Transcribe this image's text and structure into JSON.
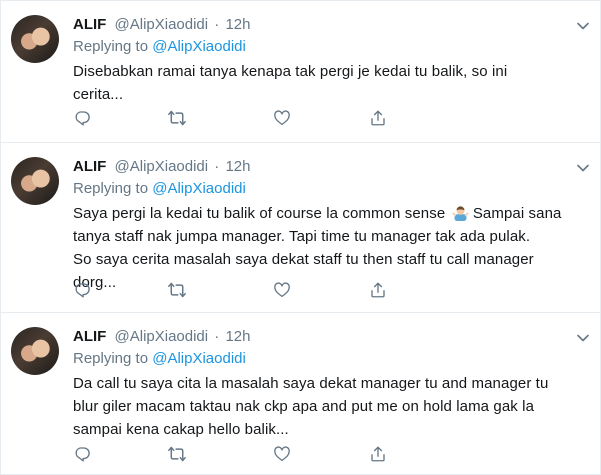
{
  "tweets": [
    {
      "name": "ALIF",
      "handle": "@AlipXiaodidi",
      "separator": "·",
      "time": "12h",
      "replying_prefix": "Replying to",
      "replying_handle": "@AlipXiaodidi",
      "text_lines": [
        "Disebabkan ramai tanya kenapa tak pergi je kedai tu balik, so ini",
        "cerita..."
      ]
    },
    {
      "name": "ALIF",
      "handle": "@AlipXiaodidi",
      "separator": "·",
      "time": "12h",
      "replying_prefix": "Replying to",
      "replying_handle": "@AlipXiaodidi",
      "text_line1_a": "Saya pergi la kedai tu balik of course la common sense",
      "text_line1_b": "Sampai sana",
      "text_lines_rest": [
        "tanya staff nak jumpa manager. Tapi time tu manager tak ada pulak.",
        "So saya cerita masalah saya dekat staff tu then staff tu call manager",
        "dorg..."
      ],
      "emoji_icon": "man-shrugging-emoji-icon"
    },
    {
      "name": "ALIF",
      "handle": "@AlipXiaodidi",
      "separator": "·",
      "time": "12h",
      "replying_prefix": "Replying to",
      "replying_handle": "@AlipXiaodidi",
      "text_lines": [
        "Da call tu saya cita la masalah saya dekat manager tu and manager tu",
        "blur giler macam taktau nak ckp apa and put me on hold lama gak la",
        "sampai kena cakap hello balik..."
      ]
    }
  ],
  "icons": {
    "reply": "reply-icon",
    "retweet": "retweet-icon",
    "like": "heart-icon",
    "share": "share-icon",
    "caret": "chevron-down-icon"
  },
  "colors": {
    "link": "#1b95e0",
    "secondary_text": "#657786",
    "icon": "#657786",
    "divider": "#e6ecf0"
  }
}
